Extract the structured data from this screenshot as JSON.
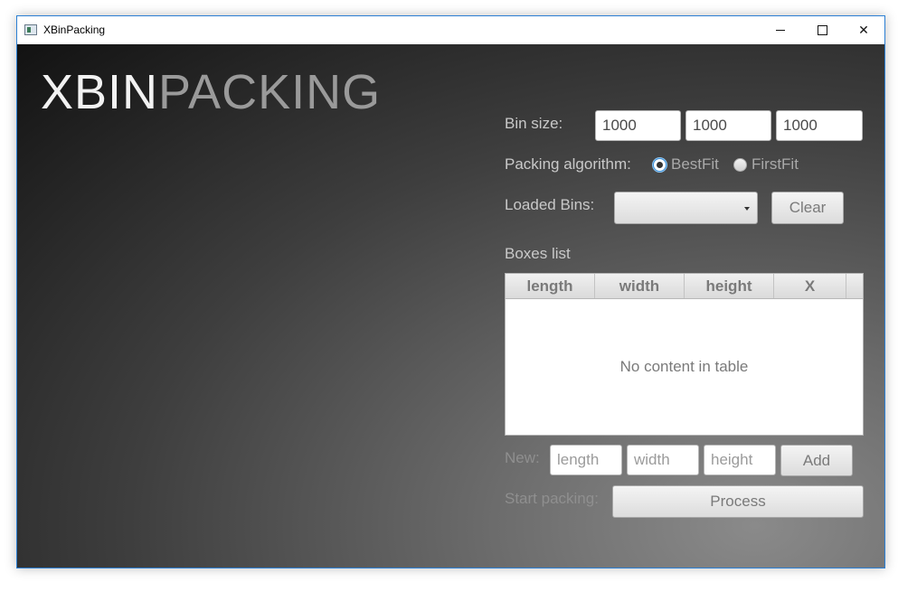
{
  "window": {
    "title": "XBinPacking",
    "controls": {
      "minimize": "—",
      "maximize": "☐",
      "close": "✕"
    }
  },
  "logo": {
    "part1": "XBIN",
    "part2": "PACKING"
  },
  "bin_size": {
    "label": "Bin size:",
    "values": [
      "1000",
      "1000",
      "1000"
    ]
  },
  "algorithm": {
    "label": "Packing algorithm:",
    "options": [
      {
        "label": "BestFit",
        "selected": true
      },
      {
        "label": "FirstFit",
        "selected": false
      }
    ]
  },
  "loaded_bins": {
    "label": "Loaded Bins:",
    "value": "",
    "clear_label": "Clear"
  },
  "boxes": {
    "label": "Boxes list",
    "columns": [
      "length",
      "width",
      "height",
      "X"
    ],
    "rows": [],
    "empty_text": "No content in table"
  },
  "new_box": {
    "label": "New:",
    "placeholders": {
      "length": "length",
      "width": "width",
      "height": "height"
    },
    "add_label": "Add"
  },
  "packing": {
    "label": "Start packing:",
    "process_label": "Process"
  },
  "colors": {
    "accent": "#3c8fd6",
    "window_border": "#2b7fd4"
  }
}
